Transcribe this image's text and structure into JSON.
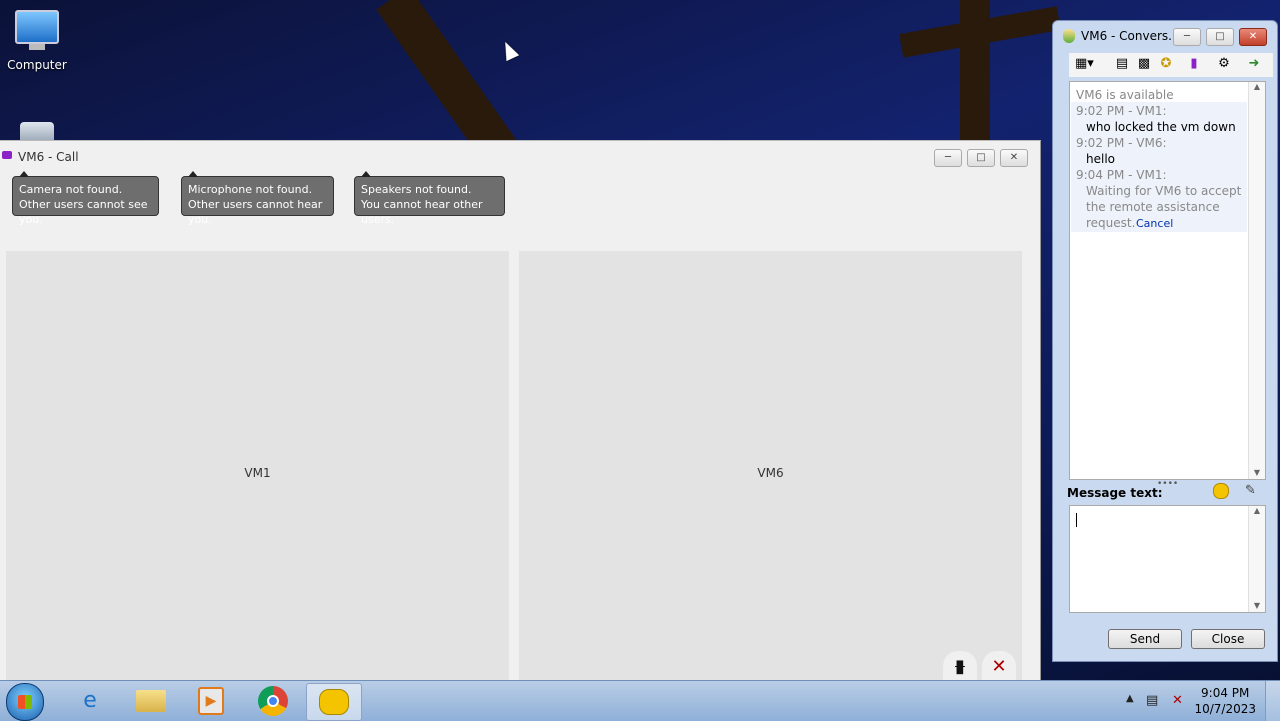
{
  "desktop": {
    "icons": [
      {
        "label": "Computer",
        "icon": "computer-icon"
      },
      {
        "label": "",
        "icon": "recycle-bin-icon"
      }
    ]
  },
  "call_window": {
    "title": "VM6 - Call",
    "tooltips": [
      {
        "line1": "Camera not found.",
        "line2": "Other users cannot see you."
      },
      {
        "line1": "Microphone not found.",
        "line2": "Other users cannot hear you."
      },
      {
        "line1": "Speakers not found.",
        "line2": "You cannot hear other users."
      }
    ],
    "panes": [
      {
        "label": "VM1"
      },
      {
        "label": "VM6"
      }
    ]
  },
  "conversation_window": {
    "title": "VM6 - Convers...",
    "history": {
      "status": "VM6 is available",
      "entries": [
        {
          "header": "9:02 PM - VM1:",
          "text": "who locked the vm down"
        },
        {
          "header": "9:02 PM - VM6:",
          "text": "hello"
        },
        {
          "header": "9:04 PM - VM1:",
          "text_lines": [
            "Waiting for VM6 to accept",
            "the remote assistance",
            "request."
          ],
          "link": "Cancel"
        }
      ]
    },
    "message_label": "Message text:",
    "message_value": "",
    "send_label": "Send",
    "close_label": "Close"
  },
  "taskbar": {
    "apps": [
      "start-orb",
      "internet-explorer-icon",
      "file-explorer-icon",
      "media-player-icon",
      "chrome-icon",
      "messenger-icon"
    ],
    "time": "9:04 PM",
    "date": "10/7/2023"
  },
  "colors": {
    "desktop": "#13226e",
    "taskbar": "#b9cde6",
    "link": "#0033aa"
  }
}
